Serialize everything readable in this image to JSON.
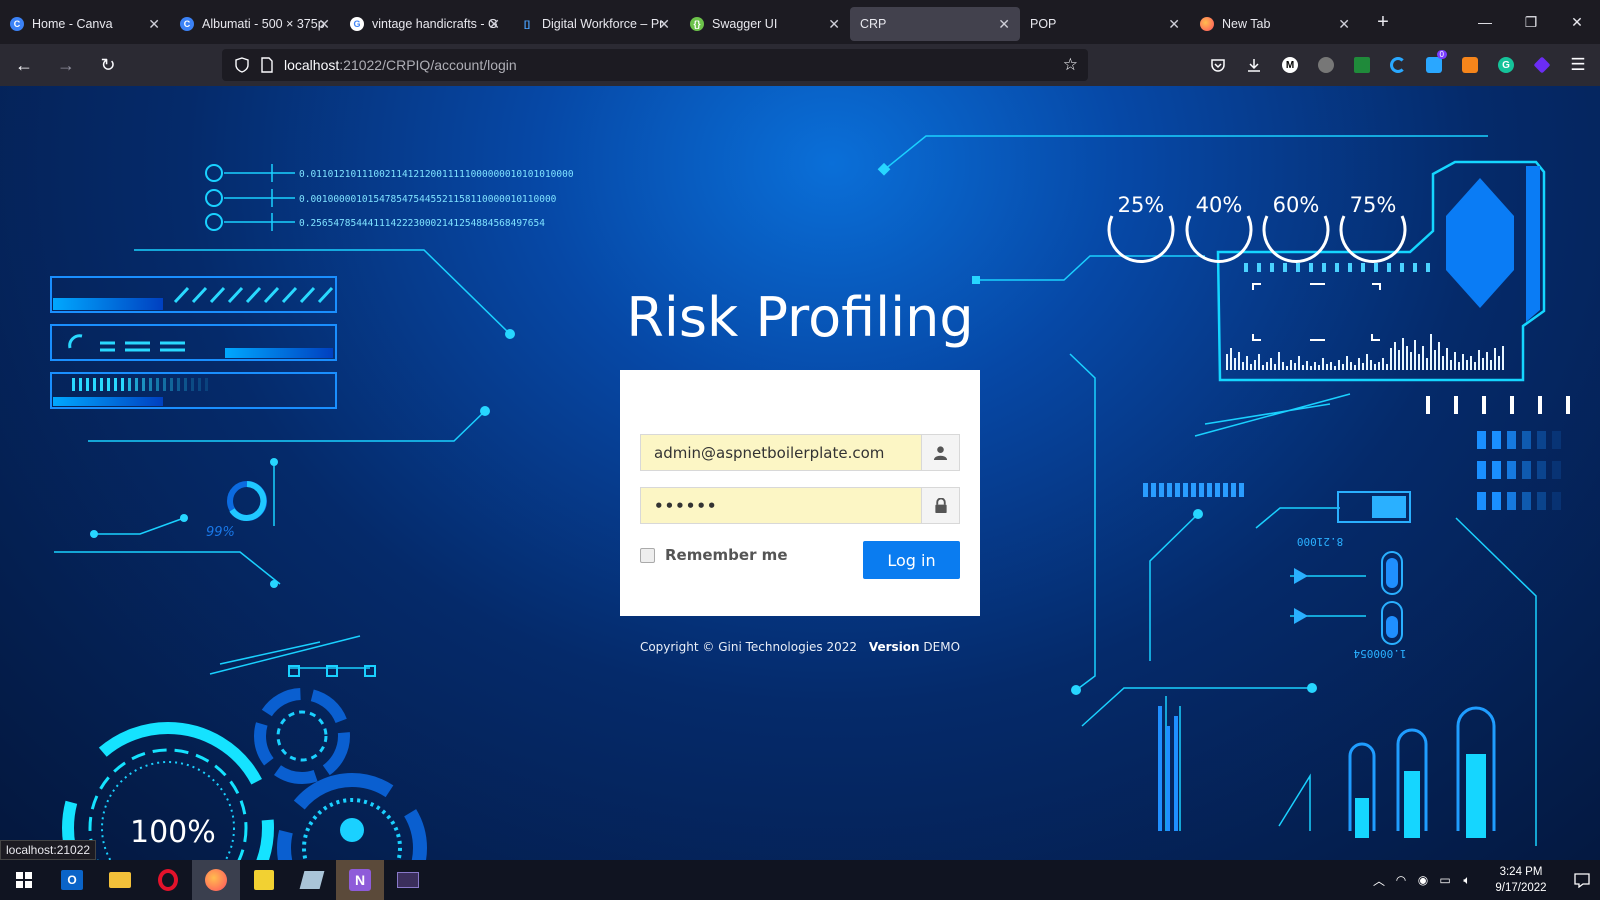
{
  "browser": {
    "tabs": [
      {
        "label": "Home - Canva",
        "favicon": "canva-icon",
        "color": "#3b82f6"
      },
      {
        "label": "Albumati - 500 × 375p",
        "favicon": "canva-icon",
        "color": "#3b82f6"
      },
      {
        "label": "vintage handicrafts - G",
        "favicon": "google-icon",
        "color": "#ffffff"
      },
      {
        "label": "Digital Workforce – Pr",
        "favicon": "bracket-icon",
        "color": "#4aa3ff"
      },
      {
        "label": "Swagger UI",
        "favicon": "swagger-icon",
        "color": "#6cc24a"
      },
      {
        "label": "CRP",
        "favicon": "",
        "color": ""
      },
      {
        "label": "POP",
        "favicon": "",
        "color": ""
      },
      {
        "label": "New Tab",
        "favicon": "firefox-icon",
        "color": "#ff7139"
      }
    ],
    "active_tab_index": 5,
    "url_host": "localhost",
    "url_path": ":21022/CRPIQ/account/login",
    "status_link": "localhost:21022",
    "extensions_badge": "0"
  },
  "login": {
    "title": "Risk Profiling",
    "email_value": "admin@aspnetboilerplate.com",
    "password_value": "••••••",
    "remember_label": "Remember me",
    "login_button": "Log in",
    "copyright": "Copyright © Gini Technologies 2022",
    "version_label": "Version",
    "version_value": "DEMO"
  },
  "decor": {
    "binary_lines": [
      "0.0110121011100211412120011111000000010101010000",
      "0.0010000010154785475445521158110000010110000",
      "0.25654785444111422230002141254884568497654"
    ],
    "percent_small": "99%",
    "percent_big": "100%",
    "gauges": [
      "25%",
      "40%",
      "60%",
      "75%"
    ],
    "readout_1": "8.21000",
    "readout_2": "1.000054"
  },
  "taskbar": {
    "time": "3:24 PM",
    "date": "9/17/2022"
  }
}
